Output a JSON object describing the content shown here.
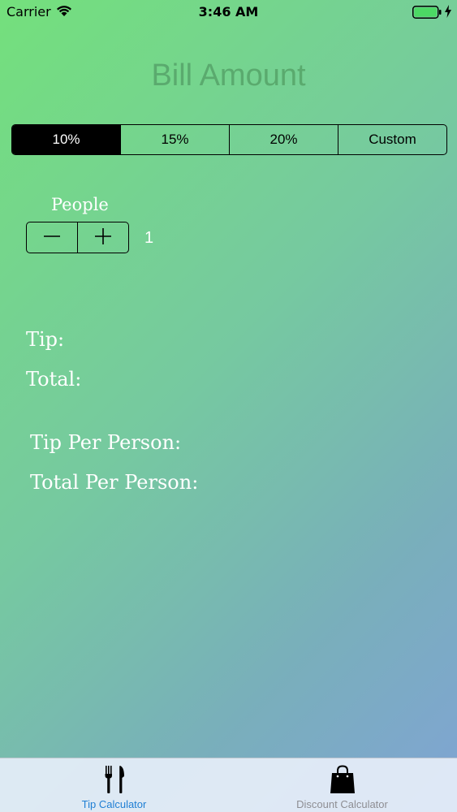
{
  "status_bar": {
    "carrier": "Carrier",
    "time": "3:46 AM",
    "icons": [
      "wifi-icon",
      "battery-icon",
      "charging-bolt-icon"
    ],
    "battery_color": "#4cd964"
  },
  "bill": {
    "placeholder": "Bill Amount"
  },
  "tip_options": {
    "segments": [
      "10%",
      "15%",
      "20%",
      "Custom"
    ],
    "selected": "10%"
  },
  "people": {
    "label": "People",
    "count": "1",
    "decrement_icon": "minus-icon",
    "increment_icon": "plus-icon"
  },
  "results": {
    "tip_label": "Tip:",
    "total_label": "Total:",
    "tip_per_person_label": "Tip Per Person:",
    "total_per_person_label": "Total Per Person:"
  },
  "tab_bar": {
    "items": [
      {
        "label": "Tip Calculator",
        "icon": "fork-knife-icon",
        "active": true
      },
      {
        "label": "Discount Calculator",
        "icon": "shopping-bag-icon",
        "active": false
      }
    ],
    "active_color": "#1f7fd4",
    "inactive_color": "#8e8e93"
  }
}
